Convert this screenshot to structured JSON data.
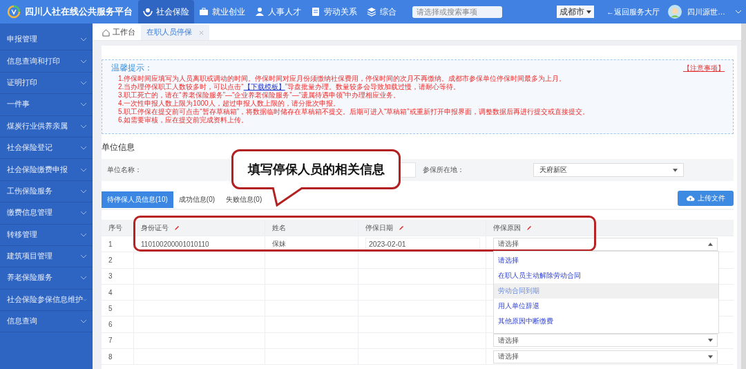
{
  "header": {
    "title": "四川人社在线公共服务平台",
    "nav": [
      {
        "label": "社会保险",
        "kind": "hands",
        "selected": true
      },
      {
        "label": "就业创业",
        "kind": "briefcase",
        "selected": false
      },
      {
        "label": "人事人才",
        "kind": "person",
        "selected": false
      },
      {
        "label": "劳动关系",
        "kind": "document",
        "selected": false
      },
      {
        "label": "综合",
        "kind": "layers",
        "selected": false
      }
    ],
    "search": {
      "placeholder": "请选择或搜索事项"
    },
    "city": "成都市",
    "back": "←返回服务大厅",
    "user": "四川源世…"
  },
  "sidebar": {
    "items": [
      {
        "label": "申报管理"
      },
      {
        "label": "信息查询和打印"
      },
      {
        "label": "证明打印"
      },
      {
        "label": "一件事"
      },
      {
        "label": "煤炭行业供养亲属"
      },
      {
        "label": "社会保险登记"
      },
      {
        "label": "社会保险缴费申报"
      },
      {
        "label": "工伤保险服务"
      },
      {
        "label": "缴费信息管理"
      },
      {
        "label": "转移管理"
      },
      {
        "label": "建筑项目管理"
      },
      {
        "label": "养老保险服务"
      },
      {
        "label": "社会保险参保信息维护"
      },
      {
        "label": "信息查询"
      }
    ]
  },
  "tabs": [
    {
      "label": "工作台",
      "kind": "home",
      "selected": false
    },
    {
      "label": "在职人员停保",
      "kind": "closable",
      "selected": true
    }
  ],
  "notice": {
    "title": "温馨提示：",
    "link": "【注意事项】",
    "lines": [
      {
        "text": "1.停保时间应填写为人员离职或调动的时间。停保时间对应月份须缴纳社保费用，停保时间的次月不再缴纳。成都市参保单位停保时间最多为上月。"
      },
      {
        "text": "2.当办理停保职工人数较多时，可以点击“",
        "link": "【下载模板】",
        "after": "”导盘批量办理。数量较多会导致加载过慢，请耐心等待。"
      },
      {
        "text": "3.职工死亡的，请在“养老保险服务”—“企业养老保险服务”—“遗属待遇申领”中办理相应业务。"
      },
      {
        "text": "4.一次性申报人数上限为1000人，超过申报人数上限的，请分批次申报。"
      },
      {
        "text": "5.职工停保在提交前可点击“暂存草稿箱”，将数据临时储存在草稿箱不提交。后期可进入“草稿箱”或重新打开申报界面，调整数据后再进行提交或直接提交。"
      },
      {
        "text": "6.如需要审核，应在提交前完成资料上传。"
      }
    ]
  },
  "unit": {
    "title": "单位信息",
    "name_label": "单位名称：",
    "location_label": "参保所在地：",
    "location": "天府新区"
  },
  "subtabs": [
    {
      "label": "待停保人员信息(10)",
      "selected": true
    },
    {
      "label": "成功信息(0)",
      "selected": false
    },
    {
      "label": "失败信息(0)",
      "selected": false
    }
  ],
  "upload": "上传文件",
  "table": {
    "columns": [
      {
        "label": "序号",
        "editable": false
      },
      {
        "label": "身份证号",
        "editable": true
      },
      {
        "label": "姓名",
        "editable": false
      },
      {
        "label": "停保日期",
        "editable": true
      },
      {
        "label": "停保原因",
        "editable": true
      }
    ],
    "rows": [
      {
        "index": "1",
        "id": "110100200001010110",
        "name": "保妹",
        "date": "2023-02-01",
        "reason": "请选择",
        "kind": "open"
      },
      {
        "index": "2",
        "kind": "hidden"
      },
      {
        "index": "3",
        "kind": "hidden"
      },
      {
        "index": "4",
        "kind": "hidden"
      },
      {
        "index": "5",
        "kind": "hidden"
      },
      {
        "index": "6",
        "kind": "hidden"
      },
      {
        "index": "7",
        "reason": "请选择",
        "kind": "closed"
      },
      {
        "index": "8",
        "reason": "请选择",
        "kind": "closed"
      }
    ],
    "options": [
      {
        "label": "请选择",
        "selected": false
      },
      {
        "label": "在职人员主动解除劳动合同",
        "selected": false
      },
      {
        "label": "劳动合同到期",
        "selected": true
      },
      {
        "label": "用人单位辞退",
        "selected": false
      },
      {
        "label": "其他原因中断缴费",
        "selected": false
      }
    ]
  },
  "callout": "填写停保人员的相关信息"
}
